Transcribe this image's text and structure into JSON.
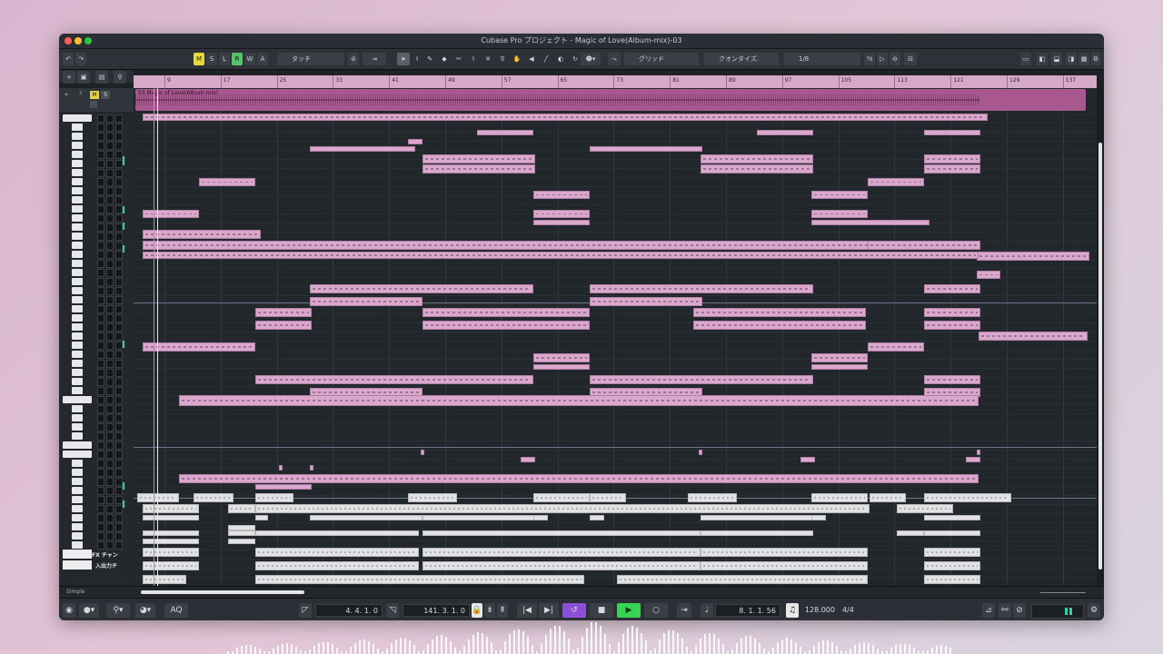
{
  "window": {
    "title": "Cubase Pro プロジェクト - Magic of Love(Album-mix)-03"
  },
  "toolbar": {
    "mode_buttons": [
      "M",
      "S",
      "L",
      "R",
      "W",
      "A"
    ],
    "automation_mode": "タッチ",
    "snap_type": "グリッド",
    "quantize_label": "クオンタイズ.",
    "quantize_value": "1/8"
  },
  "ruler": {
    "bars": [
      "9",
      "17",
      "25",
      "33",
      "41",
      "49",
      "57",
      "65",
      "73",
      "81",
      "89",
      "97",
      "105",
      "113",
      "121",
      "129",
      "137"
    ]
  },
  "audio_track": {
    "clip_name": "03 Magic of Love(Album-mix)",
    "number": "2",
    "m_label": "M",
    "s_label": "S"
  },
  "track_labels": {
    "fx_channel": "FX チャン",
    "io_channel": "入出力チ"
  },
  "bottom": {
    "inspector_mode": "Simple",
    "aq": "AQ"
  },
  "transport": {
    "left_locator": "4. 4. 1.  0",
    "right_locator": "141. 3. 1.  0",
    "position": "8. 1. 1.  56",
    "tempo": "128.000",
    "signature": "4/4"
  },
  "colors": {
    "clip": "#d9a8cc",
    "audio_clip": "#a8578f",
    "ruler": "#d7a9c9",
    "play": "#39d353",
    "cycle": "#8b4fd8",
    "meter": "#2bd1a8"
  },
  "icons": [
    "undo-icon",
    "redo-icon",
    "pointer-icon",
    "pencil-icon",
    "eraser-icon",
    "scissors-icon",
    "glue-icon",
    "mute-icon",
    "zoom-icon",
    "hand-icon",
    "speaker-icon",
    "play-icon",
    "stop-icon",
    "record-icon",
    "cycle-icon",
    "rewind-icon",
    "forward-icon",
    "metronome-icon",
    "gear-icon"
  ]
}
